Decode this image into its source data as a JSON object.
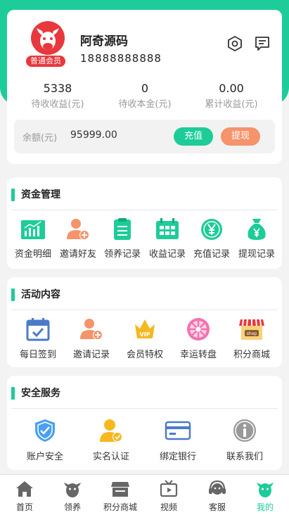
{
  "colors": {
    "accent": "#1dcc99",
    "withdraw": "#f5936b",
    "badge": "#e8383d"
  },
  "profile": {
    "username": "阿奇源码",
    "phone": "18888888888",
    "member_level": "普通会员",
    "stats": [
      {
        "value": "5338",
        "label": "待收收益(元)"
      },
      {
        "value": "0",
        "label": "待收本金(元)"
      },
      {
        "value": "0.00",
        "label": "累计收益(元)"
      }
    ],
    "balance_label": "余额(元)",
    "balance_value": "95999.00",
    "recharge_label": "充值",
    "withdraw_label": "提现"
  },
  "fund_section": {
    "title": "资金管理",
    "items": [
      {
        "label": "资金明细",
        "icon": "bar-chart-icon"
      },
      {
        "label": "邀请好友",
        "icon": "invite-user-icon"
      },
      {
        "label": "领养记录",
        "icon": "clipboard-list-icon"
      },
      {
        "label": "收益记录",
        "icon": "calendar-grid-icon"
      },
      {
        "label": "充值记录",
        "icon": "yen-coin-icon"
      },
      {
        "label": "提现记录",
        "icon": "money-bag-icon"
      }
    ]
  },
  "activity_section": {
    "title": "活动内容",
    "items": [
      {
        "label": "每日签到",
        "icon": "calendar-check-icon"
      },
      {
        "label": "邀请记录",
        "icon": "invite-user-icon"
      },
      {
        "label": "会员特权",
        "icon": "vip-crown-icon"
      },
      {
        "label": "幸运转盘",
        "icon": "lucky-wheel-icon"
      },
      {
        "label": "积分商城",
        "icon": "shop-icon"
      }
    ]
  },
  "security_section": {
    "title": "安全服务",
    "items": [
      {
        "label": "账户安全",
        "icon": "shield-check-icon"
      },
      {
        "label": "实名认证",
        "icon": "verified-user-icon"
      },
      {
        "label": "绑定银行",
        "icon": "bank-card-icon"
      },
      {
        "label": "联系我们",
        "icon": "info-icon"
      }
    ]
  },
  "tabbar": {
    "items": [
      {
        "label": "首页",
        "icon": "home-icon"
      },
      {
        "label": "领养",
        "icon": "ox-head-icon"
      },
      {
        "label": "积分商城",
        "icon": "store-icon"
      },
      {
        "label": "视频",
        "icon": "video-icon"
      },
      {
        "label": "客服",
        "icon": "headset-icon"
      },
      {
        "label": "我的",
        "icon": "ox-head-icon",
        "active": true
      }
    ]
  }
}
